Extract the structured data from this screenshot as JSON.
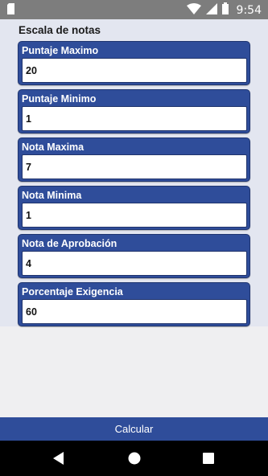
{
  "status_bar": {
    "time": "9:54",
    "icons": [
      "sim-card-icon",
      "wifi-icon",
      "signal-icon",
      "battery-icon"
    ]
  },
  "page": {
    "title": "Escala de notas"
  },
  "fields": [
    {
      "label": "Puntaje Maximo",
      "value": "20"
    },
    {
      "label": "Puntaje Minimo",
      "value": "1"
    },
    {
      "label": "Nota Maxima",
      "value": "7"
    },
    {
      "label": "Nota Minima",
      "value": "1"
    },
    {
      "label": "Nota de Aprobación",
      "value": "4"
    },
    {
      "label": "Porcentaje Exigencia",
      "value": "60"
    }
  ],
  "actions": {
    "calculate_label": "Calcular"
  },
  "nav_bar": {
    "icons": [
      "back-icon",
      "home-icon",
      "recents-icon"
    ]
  },
  "colors": {
    "accent": "#2f4d9a",
    "content_bg": "#e3e6f0",
    "page_bg": "#efeff1"
  }
}
